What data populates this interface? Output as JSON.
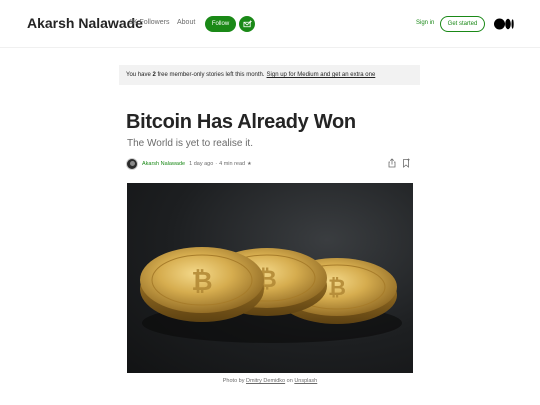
{
  "header": {
    "publication": "Akarsh Nalawade",
    "followers": "1K Followers",
    "about": "About",
    "follow": "Follow",
    "sign_in": "Sign in",
    "get_started": "Get started"
  },
  "banner": {
    "prefix": "You have",
    "count": "2",
    "middle": "free member-only stories left this month.",
    "link": "Sign up for Medium and get an extra one"
  },
  "article": {
    "title": "Bitcoin Has Already Won",
    "subtitle": "The World is yet to realise it.",
    "author": "Akarsh Nalawade",
    "time_ago": "1 day ago",
    "read_time": "4 min read",
    "star": "★"
  },
  "caption": {
    "prefix": "Photo by",
    "photographer": "Dmitry Demidko",
    "on": "on",
    "source": "Unsplash"
  },
  "colors": {
    "brand_green": "#1a8917",
    "banner_bg": "#f2f2f2",
    "photo_bg": "#1d1f21",
    "coin_gold": "#c8a041"
  },
  "icons": {
    "mail": "mail-plus-icon",
    "logo": "medium-logo-icon",
    "share": "share-icon",
    "bookmark": "bookmark-icon"
  }
}
